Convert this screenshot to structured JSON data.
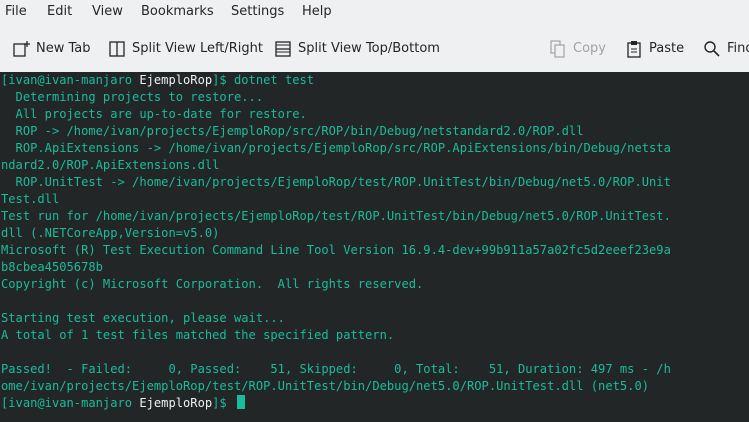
{
  "menu": [
    "File",
    "Edit",
    "View",
    "Bookmarks",
    "Settings",
    "Help"
  ],
  "toolbar": {
    "new_tab": "New Tab",
    "split_lr": "Split View Left/Right",
    "split_tb": "Split View Top/Bottom",
    "copy": "Copy",
    "paste": "Paste",
    "find": "Find"
  },
  "terminal": {
    "prompt_user": "[ivan@ivan-manjaro ",
    "prompt_dir": "EjemploRop",
    "prompt_end": "]$ ",
    "command": "dotnet test",
    "lines": [
      "  Determining projects to restore...",
      "  All projects are up-to-date for restore.",
      "  ROP -> /home/ivan/projects/EjemploRop/src/ROP/bin/Debug/netstandard2.0/ROP.dll",
      "  ROP.ApiExtensions -> /home/ivan/projects/EjemploRop/src/ROP.ApiExtensions/bin/Debug/netsta",
      "ndard2.0/ROP.ApiExtensions.dll",
      "  ROP.UnitTest -> /home/ivan/projects/EjemploRop/test/ROP.UnitTest/bin/Debug/net5.0/ROP.Unit",
      "Test.dll",
      "Test run for /home/ivan/projects/EjemploRop/test/ROP.UnitTest/bin/Debug/net5.0/ROP.UnitTest.",
      "dll (.NETCoreApp,Version=v5.0)",
      "Microsoft (R) Test Execution Command Line Tool Version 16.9.4-dev+99b911a57a02fc5d2eeef23e9a",
      "b8cbea4505678b",
      "Copyright (c) Microsoft Corporation.  All rights reserved.",
      "",
      "Starting test execution, please wait...",
      "A total of 1 test files matched the specified pattern.",
      "",
      "Passed!  - Failed:     0, Passed:    51, Skipped:     0, Total:    51, Duration: 497 ms - /h",
      "ome/ivan/projects/EjemploRop/test/ROP.UnitTest/bin/Debug/net5.0/ROP.UnitTest.dll (net5.0)"
    ]
  }
}
